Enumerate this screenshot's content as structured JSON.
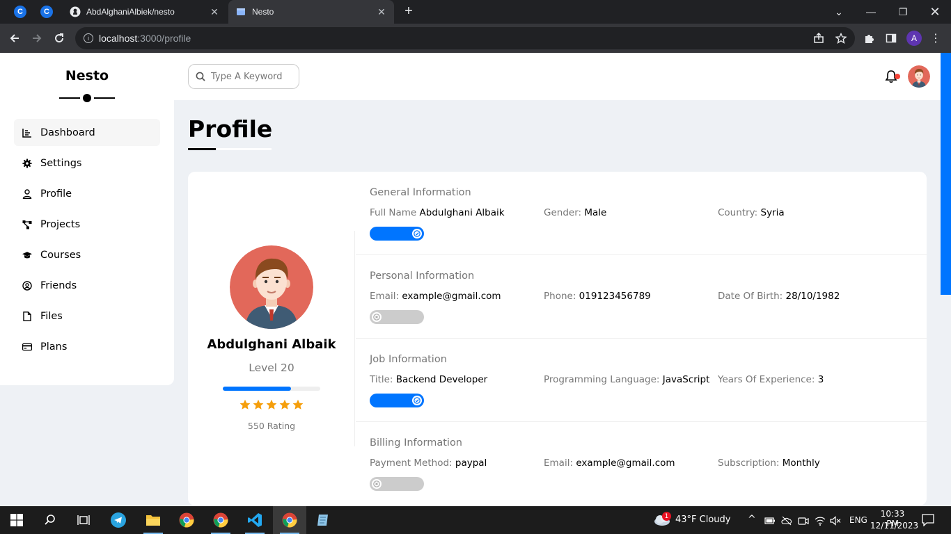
{
  "browser": {
    "tabs": [
      {
        "label": "AbdAlghaniAlbiek/nesto",
        "active": false
      },
      {
        "label": "Nesto",
        "active": true
      }
    ],
    "url_host": "localhost",
    "url_path": ":3000/profile",
    "profile_initial": "A"
  },
  "app": {
    "brand": "Nesto",
    "sidebar": [
      {
        "label": "Dashboard",
        "icon": "chart-icon"
      },
      {
        "label": "Settings",
        "icon": "gear-icon"
      },
      {
        "label": "Profile",
        "icon": "user-icon"
      },
      {
        "label": "Projects",
        "icon": "diagram-icon"
      },
      {
        "label": "Courses",
        "icon": "graduation-cap-icon"
      },
      {
        "label": "Friends",
        "icon": "user-circle-icon"
      },
      {
        "label": "Files",
        "icon": "file-icon"
      },
      {
        "label": "Plans",
        "icon": "credit-card-icon"
      }
    ],
    "search_placeholder": "Type A Keyword",
    "page_title": "Profile"
  },
  "profile": {
    "name": "Abdulghani Albaik",
    "level": "Level 20",
    "level_progress": 0.7,
    "stars": 5,
    "rating": "550 Rating"
  },
  "sections": [
    {
      "title": "General Information",
      "toggle_on": true,
      "fields": [
        {
          "key": "Full Name",
          "value": "Abdulghani Albaik"
        },
        {
          "key": "Gender:",
          "value": "Male"
        },
        {
          "key": "Country:",
          "value": "Syria"
        }
      ]
    },
    {
      "title": "Personal Information",
      "toggle_on": false,
      "fields": [
        {
          "key": "Email:",
          "value": "example@gmail.com"
        },
        {
          "key": "Phone:",
          "value": "019123456789"
        },
        {
          "key": "Date Of Birth:",
          "value": "28/10/1982"
        }
      ]
    },
    {
      "title": "Job Information",
      "toggle_on": true,
      "fields": [
        {
          "key": "Title:",
          "value": "Backend Developer"
        },
        {
          "key": "Programming Language:",
          "value": "JavaScript"
        },
        {
          "key": "Years Of Experience:",
          "value": "3"
        }
      ]
    },
    {
      "title": "Billing Information",
      "toggle_on": false,
      "fields": [
        {
          "key": "Payment Method:",
          "value": "paypal"
        },
        {
          "key": "Email:",
          "value": "example@gmail.com"
        },
        {
          "key": "Subscription:",
          "value": "Monthly"
        }
      ]
    }
  ],
  "taskbar": {
    "weather_badge": "1",
    "weather": "43°F  Cloudy",
    "lang": "ENG",
    "time": "10:33 PM",
    "date": "12/11/2023"
  },
  "colors": {
    "accent": "#0075ff",
    "star": "#f59e0b",
    "avatar_bg": "#e2685a"
  }
}
